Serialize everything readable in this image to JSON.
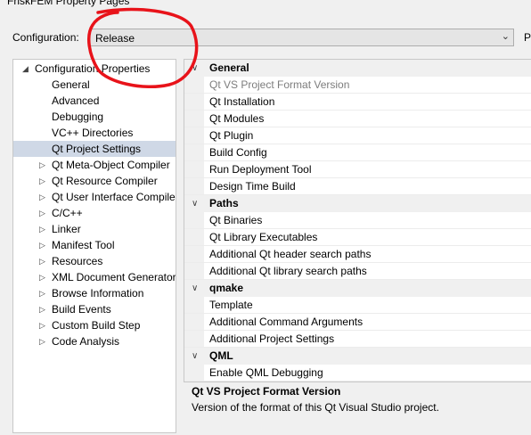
{
  "window": {
    "title": "FriskFEM Property Pages"
  },
  "configuration": {
    "label": "Configuration:",
    "value": "Release",
    "platform_label_partial": "P"
  },
  "tree": {
    "items": [
      {
        "label": "Configuration Properties",
        "level": 0,
        "expanded": true
      },
      {
        "label": "General",
        "level": 1
      },
      {
        "label": "Advanced",
        "level": 1
      },
      {
        "label": "Debugging",
        "level": 1
      },
      {
        "label": "VC++ Directories",
        "level": 1
      },
      {
        "label": "Qt Project Settings",
        "level": 1,
        "selected": true
      },
      {
        "label": "Qt Meta-Object Compiler",
        "level": 1,
        "collapsed": true
      },
      {
        "label": "Qt Resource Compiler",
        "level": 1,
        "collapsed": true
      },
      {
        "label": "Qt User Interface Compiler",
        "level": 1,
        "collapsed": true
      },
      {
        "label": "C/C++",
        "level": 1,
        "collapsed": true
      },
      {
        "label": "Linker",
        "level": 1,
        "collapsed": true
      },
      {
        "label": "Manifest Tool",
        "level": 1,
        "collapsed": true
      },
      {
        "label": "Resources",
        "level": 1,
        "collapsed": true
      },
      {
        "label": "XML Document Generator",
        "level": 1,
        "collapsed": true
      },
      {
        "label": "Browse Information",
        "level": 1,
        "collapsed": true
      },
      {
        "label": "Build Events",
        "level": 1,
        "collapsed": true
      },
      {
        "label": "Custom Build Step",
        "level": 1,
        "collapsed": true
      },
      {
        "label": "Code Analysis",
        "level": 1,
        "collapsed": true
      }
    ]
  },
  "grid": {
    "sections": [
      {
        "name": "General",
        "items": [
          "Qt VS Project Format Version",
          "Qt Installation",
          "Qt Modules",
          "Qt Plugin",
          "Build Config",
          "Run Deployment Tool",
          "Design Time Build"
        ]
      },
      {
        "name": "Paths",
        "items": [
          "Qt Binaries",
          "Qt Library Executables",
          "Additional Qt header search paths",
          "Additional Qt library search paths"
        ]
      },
      {
        "name": "qmake",
        "items": [
          "Template",
          "Additional Command Arguments",
          "Additional Project Settings"
        ]
      },
      {
        "name": "QML",
        "items": [
          "Enable QML Debugging"
        ]
      }
    ],
    "selected_item": "Qt VS Project Format Version"
  },
  "description": {
    "title": "Qt VS Project Format Version",
    "text": "Version of the format of this Qt Visual Studio project."
  },
  "annotation_color": "#e8131a"
}
